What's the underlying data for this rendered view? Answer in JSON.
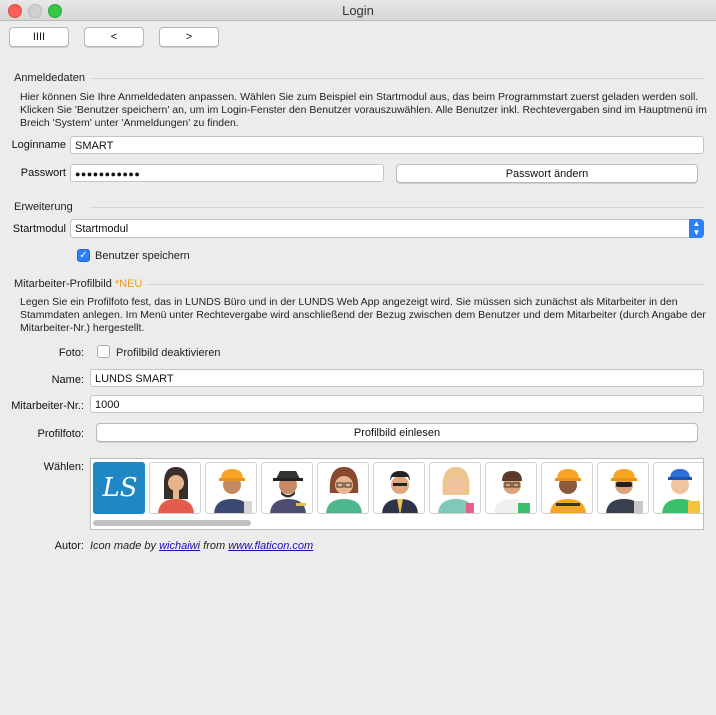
{
  "window": {
    "title": "Login"
  },
  "toolbar": {
    "btn1": "IIII",
    "btn2": "<",
    "btn3": ">"
  },
  "anmeldedaten": {
    "heading": "Anmeldedaten",
    "desc_lines": [
      "Hier können Sie Ihre Anmeldedaten anpassen. Wählen Sie zum Beispiel ein Startmodul aus, das beim Programmstart zuerst geladen werden soll.",
      "Klicken Sie 'Benutzer speichern' an, um im Login-Fenster den Benutzer vorauszuwählen. Alle Benutzer inkl. Rechtevergaben sind im Hauptmenü im",
      "Breich 'System' unter 'Anmeldungen' zu finden."
    ],
    "loginname_label": "Loginname",
    "loginname_value": "SMART",
    "passwort_label": "Passwort",
    "passwort_value": "●●●●●●●●●●●",
    "passwort_button": "Passwort ändern"
  },
  "erweiterung": {
    "heading": "Erweiterung",
    "startmodul_label": "Startmodul",
    "startmodul_value": "Startmodul",
    "benutzer_speichern": "Benutzer speichern",
    "benutzer_speichern_checked": true
  },
  "profilbild": {
    "heading": "Mitarbeiter-Profilbild",
    "new_badge": "*NEU",
    "desc_lines": [
      "Legen Sie ein Profilfoto fest, das in LUNDS Büro und in der LUNDS Web App angezeigt wird. Sie müssen sich zunächst als Mitarbeiter in den",
      "Stammdaten anlegen. Im Menü unter Rechtevergabe wird anschließend der Bezug zwischen dem Benutzer und dem Mitarbeiter (durch Angabe der",
      "Mitarbeiter-Nr.) hergestellt."
    ],
    "foto_label": "Foto:",
    "foto_checkbox": "Profilbild deaktivieren",
    "foto_checked": false,
    "name_label": "Name:",
    "name_value": "LUNDS SMART",
    "nr_label": "Mitarbeiter-Nr.:",
    "nr_value": "1000",
    "profilfoto_label": "Profilfoto:",
    "profilfoto_button": "Profilbild einlesen",
    "waehlen_label": "Wählen:",
    "avatars": [
      "logo-ls",
      "woman-dark-hair",
      "construction-worker",
      "painter",
      "woman-glasses",
      "businessman",
      "woman-blonde",
      "man-glasses",
      "builder-dark",
      "worker-sunglasses",
      "worker-blue-cap"
    ],
    "logo_text": "LS",
    "autor_label": "Autor:",
    "autor_prefix": "Icon made by",
    "autor_name": "wichaiwi",
    "autor_mid": "from",
    "autor_site": "www.flaticon.com"
  },
  "colors": {
    "accent": "#2d7ff9",
    "new_badge": "#f29a1d",
    "logo_bg": "#1f87c3"
  }
}
